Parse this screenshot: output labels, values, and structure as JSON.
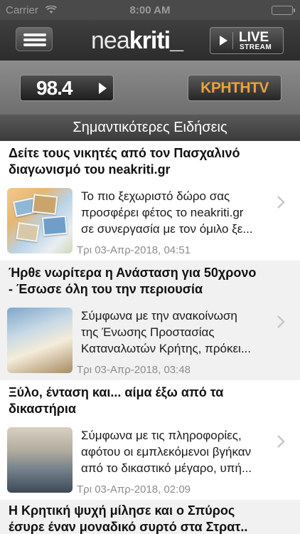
{
  "status_bar": {
    "carrier": "Carrier",
    "time": "8:00 AM"
  },
  "header": {
    "logo_part1": "nea",
    "logo_part2": "kriti_",
    "live_label": "LIVE",
    "stream_label": "STREAM"
  },
  "radio": {
    "frequency": "98.4",
    "tv_label": "ΚΡΗΤΗTV"
  },
  "section": {
    "title": "Σημαντικότερες Ειδήσεις"
  },
  "news": [
    {
      "title_line1": "Δείτε τους νικητές από τον Πασχαλινό",
      "title_line2": "διαγωνισμό του neakriti.gr",
      "summary_line1": "Το πιο ξεχωριστό δώρο σας",
      "summary_line2": "προσφέρει φέτος το neakriti.gr",
      "summary_line3": "σε συνεργασία με τον όμιλο ξε...",
      "date": "Τρι 03-Απρ-2018, 04:51"
    },
    {
      "title_line1": "Ήρθε νωρίτερα η Ανάσταση για 50χρονο",
      "title_line2": "- Έσωσε όλη του την περιουσία",
      "summary_line1": "Σύμφωνα με την ανακοίνωση",
      "summary_line2": "της Ένωσης Προστασίας",
      "summary_line3": "Καταναλωτών Κρήτης, πρόκει...",
      "date": "Τρι 03-Απρ-2018, 03:48"
    },
    {
      "title_line1": "Ξύλο, ένταση και... αίμα έξω από τα",
      "title_line2": "δικαστήρια",
      "summary_line1": "Σύμφωνα με τις πληροφορίες,",
      "summary_line2": "αφότου οι εμπλεκόμενοι βγήκαν",
      "summary_line3": "από το δικαστικό μέγαρο, υπή...",
      "date": "Τρι 03-Απρ-2018, 02:09"
    },
    {
      "title_line1": "Η Κρητική ψυχή μίλησε και ο Σπύρος",
      "title_line2": "έσυρε έναν μοναδικό συρτό στα Στρατ.."
    }
  ]
}
